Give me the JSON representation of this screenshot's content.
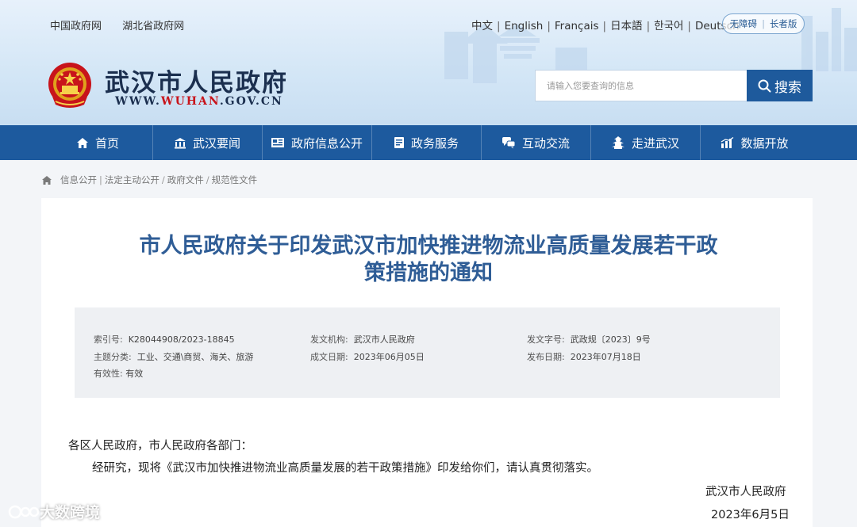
{
  "header": {
    "top_links": [
      "中国政府网",
      "湖北省政府网"
    ],
    "languages": [
      "中文",
      "English",
      "Français",
      "日本語",
      "한국어",
      "Deutsch"
    ],
    "accessibility": [
      "无障碍",
      "长者版"
    ],
    "site_title": "武汉市人民政府",
    "site_url_prefix": "WWW.",
    "site_url_highlight": "WUHAN",
    "site_url_suffix": ".GOV.CN",
    "search_placeholder": "请输入您要查询的信息",
    "search_button": "搜索"
  },
  "nav": {
    "items": [
      {
        "label": "首页",
        "icon": "home-icon"
      },
      {
        "label": "武汉要闻",
        "icon": "building-icon"
      },
      {
        "label": "政府信息公开",
        "icon": "newspaper-icon"
      },
      {
        "label": "政务服务",
        "icon": "document-icon"
      },
      {
        "label": "互动交流",
        "icon": "chat-icon"
      },
      {
        "label": "走进武汉",
        "icon": "pagoda-icon"
      },
      {
        "label": "数据开放",
        "icon": "chart-icon"
      }
    ]
  },
  "breadcrumb": [
    "信息公开",
    "法定主动公开",
    "政府文件",
    "规范性文件"
  ],
  "document": {
    "title_line1": "市人民政府关于印发武汉市加快推进物流业高质量发展若干政",
    "title_line2": "策措施的通知",
    "meta": {
      "index_label": "索引号:",
      "index_value": "K28044908/2023-18845",
      "issuer_label": "发文机构:",
      "issuer_value": "武汉市人民政府",
      "docno_label": "发文字号:",
      "docno_value": "武政规〔2023〕9号",
      "topic_label": "主题分类:",
      "topic_value": "工业、交通\\商贸、海关、旅游",
      "created_label": "成文日期:",
      "created_value": "2023年06月05日",
      "published_label": "发布日期:",
      "published_value": "2023年07月18日",
      "validity_label": "有效性:",
      "validity_value": "有效"
    },
    "salutation": "各区人民政府，市人民政府各部门：",
    "body": "经研究，现将《武汉市加快推进物流业高质量发展的若干政策措施》印发给你们，请认真贯彻落实。",
    "signature": "武汉市人民政府",
    "date": "2023年6月5日"
  },
  "watermark": "大数跨境",
  "colors": {
    "nav_bg": "#1d5a9e",
    "title": "#2f5d96",
    "accent_red": "#c8141b"
  }
}
